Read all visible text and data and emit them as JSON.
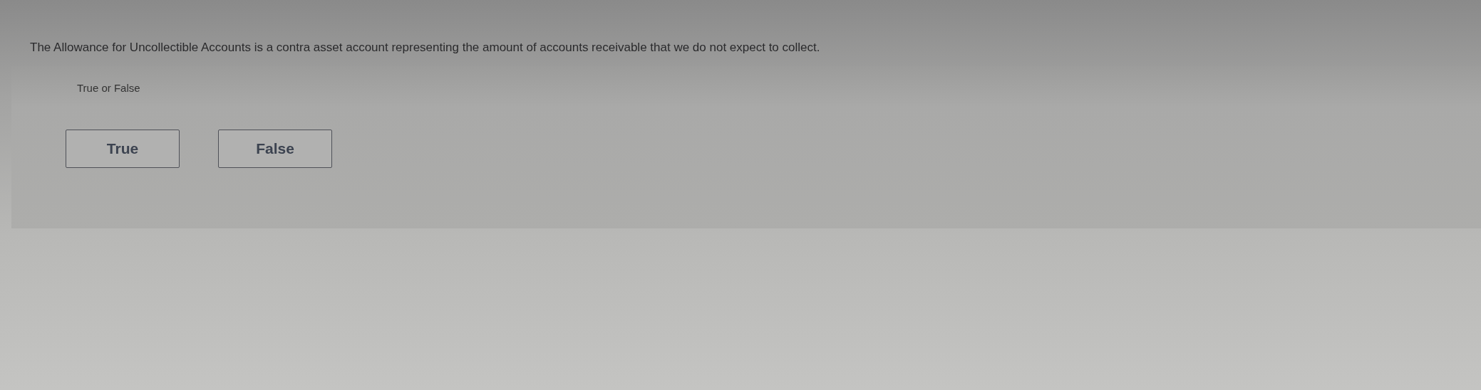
{
  "question": "The Allowance for Uncollectible Accounts is a contra asset account representing the amount of accounts receivable that we do not expect to collect.",
  "prompt": "True or False",
  "options": [
    {
      "label": "True",
      "selected": false
    },
    {
      "label": "False",
      "selected": false
    }
  ]
}
